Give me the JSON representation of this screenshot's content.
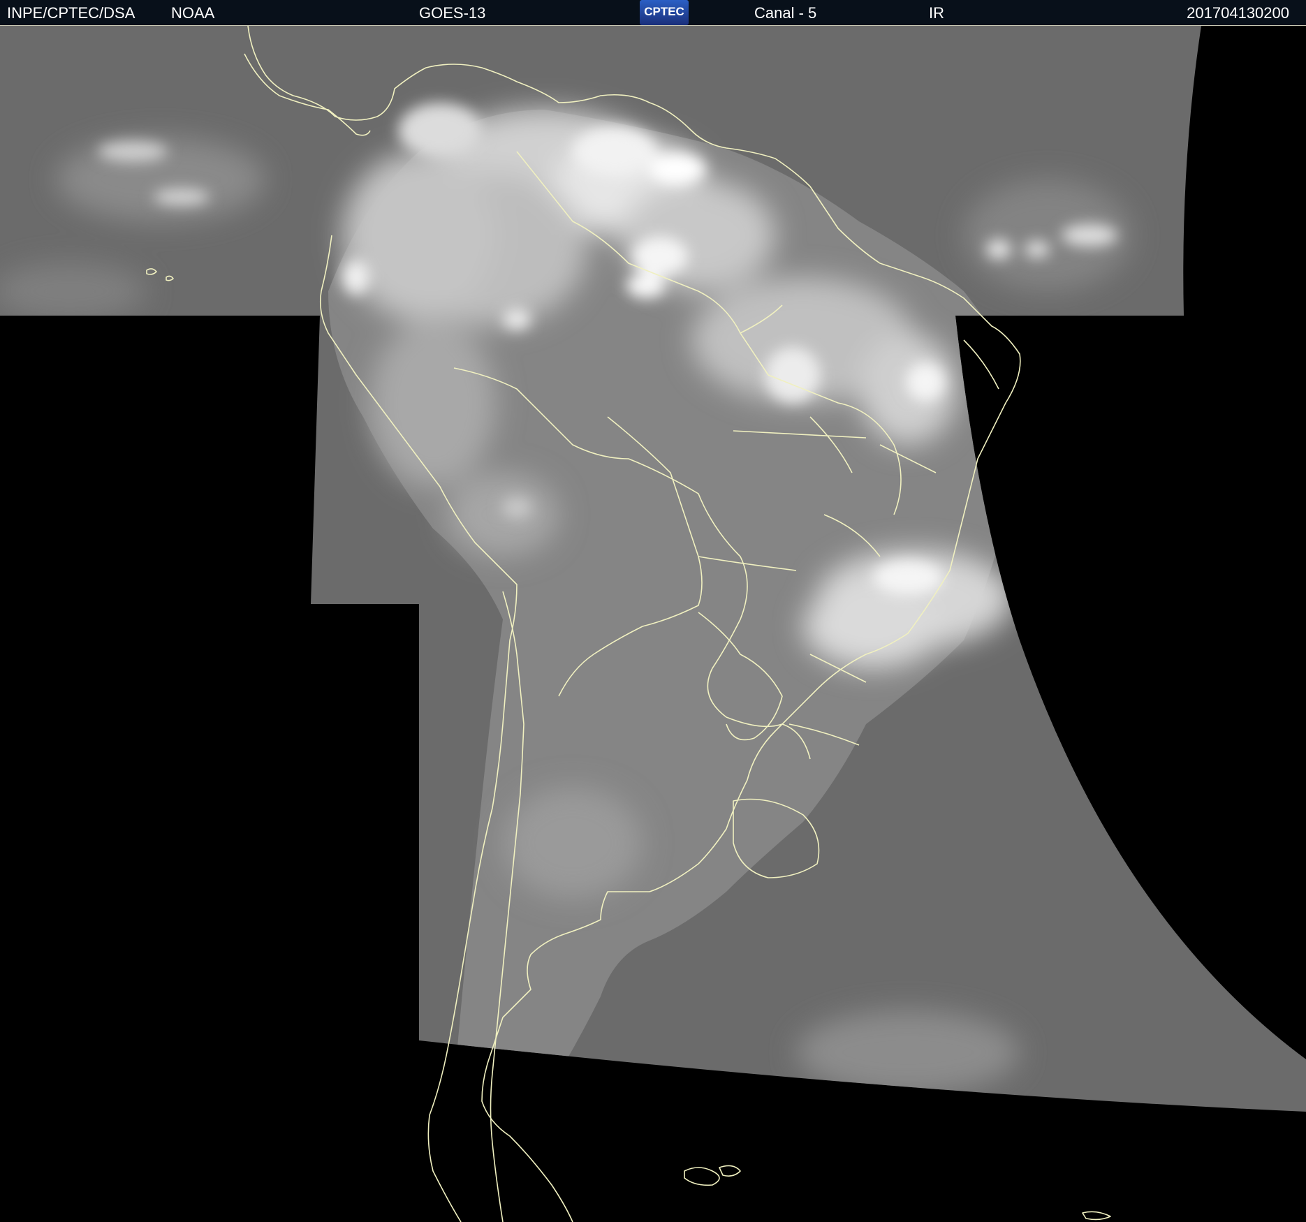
{
  "header": {
    "organization": "INPE/CPTEC/DSA",
    "agency": "NOAA",
    "satellite": "GOES-13",
    "logo_text": "CPTEC",
    "channel": "Canal - 5",
    "band": "IR",
    "timestamp": "201704130200"
  },
  "image": {
    "subject": "infrared satellite mosaic of South America with political borders",
    "colors": {
      "header_bg": "#08101a",
      "header_text": "#ffffff",
      "ocean_cloudfree": "#6e6e6e",
      "land": "#888888",
      "cloud_bright": "#f0f0f0",
      "no_data": "#000000",
      "border_lines": "#f0f0c0"
    }
  }
}
